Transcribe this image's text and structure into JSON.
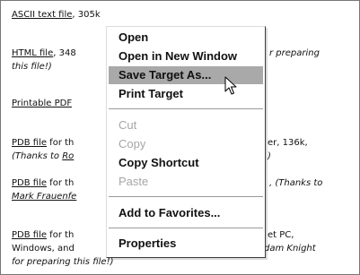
{
  "background": {
    "ascii": {
      "link": "ASCII text file",
      "rest": ", 305k"
    },
    "html": {
      "link": "HTML file",
      "rest1": ", 348",
      "rest2": "r preparing",
      "line2": "this file!)"
    },
    "printable": {
      "link": "Printable PDF"
    },
    "pdb1": {
      "link": "PDB file",
      "rest1": " for th",
      "rest2": "er, 136k,",
      "line2a": "(Thanks to ",
      "line2link": "Ro",
      "line2b": ")"
    },
    "pdb2": {
      "link": "PDB file",
      "rest1": " for th",
      "rest2": ", (Thanks to",
      "line2link": "Mark Frauenfe"
    },
    "pdb3": {
      "link": "PDB file",
      "rest1": " for th",
      "rest2": "et PC,",
      "line2a": "Windows, and",
      "line2b": "dam Knight",
      "line3": "for preparing this file!)"
    }
  },
  "context_menu": {
    "items": [
      {
        "label": "Open",
        "enabled": true
      },
      {
        "label": "Open in New Window",
        "enabled": true
      },
      {
        "label": "Save Target As...",
        "enabled": true,
        "highlighted": true
      },
      {
        "label": "Print Target",
        "enabled": true
      },
      {
        "label": "Cut",
        "enabled": false
      },
      {
        "label": "Copy",
        "enabled": false
      },
      {
        "label": "Copy Shortcut",
        "enabled": true
      },
      {
        "label": "Paste",
        "enabled": false
      },
      {
        "label": "Add to Favorites...",
        "enabled": true
      },
      {
        "label": "Properties",
        "enabled": true
      }
    ],
    "highlight_color": "#a9a9a9",
    "disabled_color": "#a6a6a6"
  },
  "cursor": {
    "icon": "arrow-pointer-icon"
  }
}
